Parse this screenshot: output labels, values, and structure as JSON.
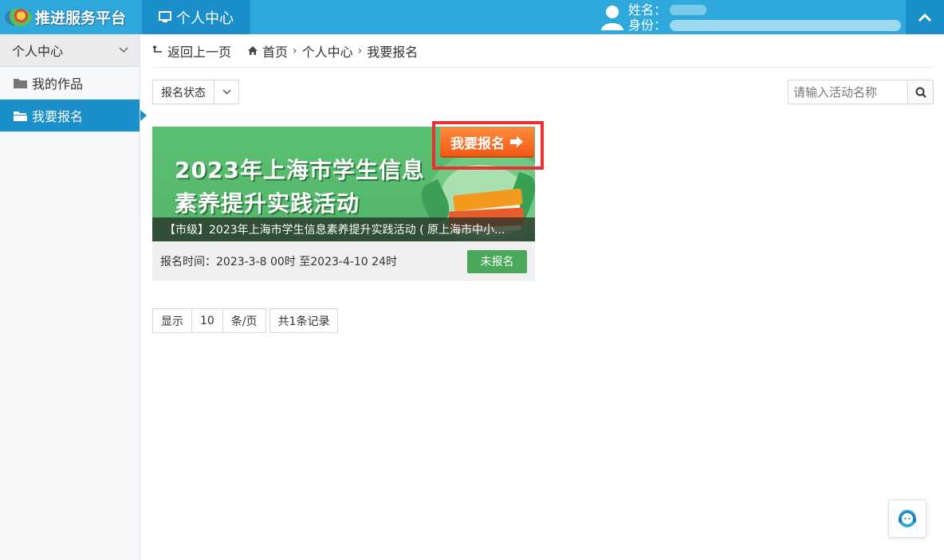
{
  "header": {
    "brand_name": "推进服务平台",
    "active_tab": "个人中心",
    "name_label": "姓名：",
    "identity_label": "身份："
  },
  "sidebar": {
    "section_title": "个人中心",
    "items": [
      {
        "label": "我的作品",
        "active": false
      },
      {
        "label": "我要报名",
        "active": true
      }
    ]
  },
  "breadcrumb": {
    "back": "返回上一页",
    "home": "首页",
    "level1": "个人中心",
    "level2": "我要报名"
  },
  "filters": {
    "status_label": "报名状态",
    "search_placeholder": "请输入活动名称"
  },
  "activity_card": {
    "banner_line1": "2023年上海市学生信息",
    "banner_line2": "素养提升实践活动",
    "join_button": "我要报名",
    "caption": "【市级】2023年上海市学生信息素养提升实践活动 ( 原上海市中小...",
    "reg_time": "报名时间：2023-3-8 00时 至2023-4-10 24时",
    "status": "未报名"
  },
  "pager": {
    "show": "显示",
    "per_page": "10",
    "unit": "条/页",
    "total": "共1条记录"
  },
  "colors": {
    "header_blue": "#2fa8dc",
    "active_blue": "#1a8fca",
    "badge_green": "#4aa85a",
    "join_orange": "#f05a14",
    "highlight_red": "#ea2f35"
  }
}
